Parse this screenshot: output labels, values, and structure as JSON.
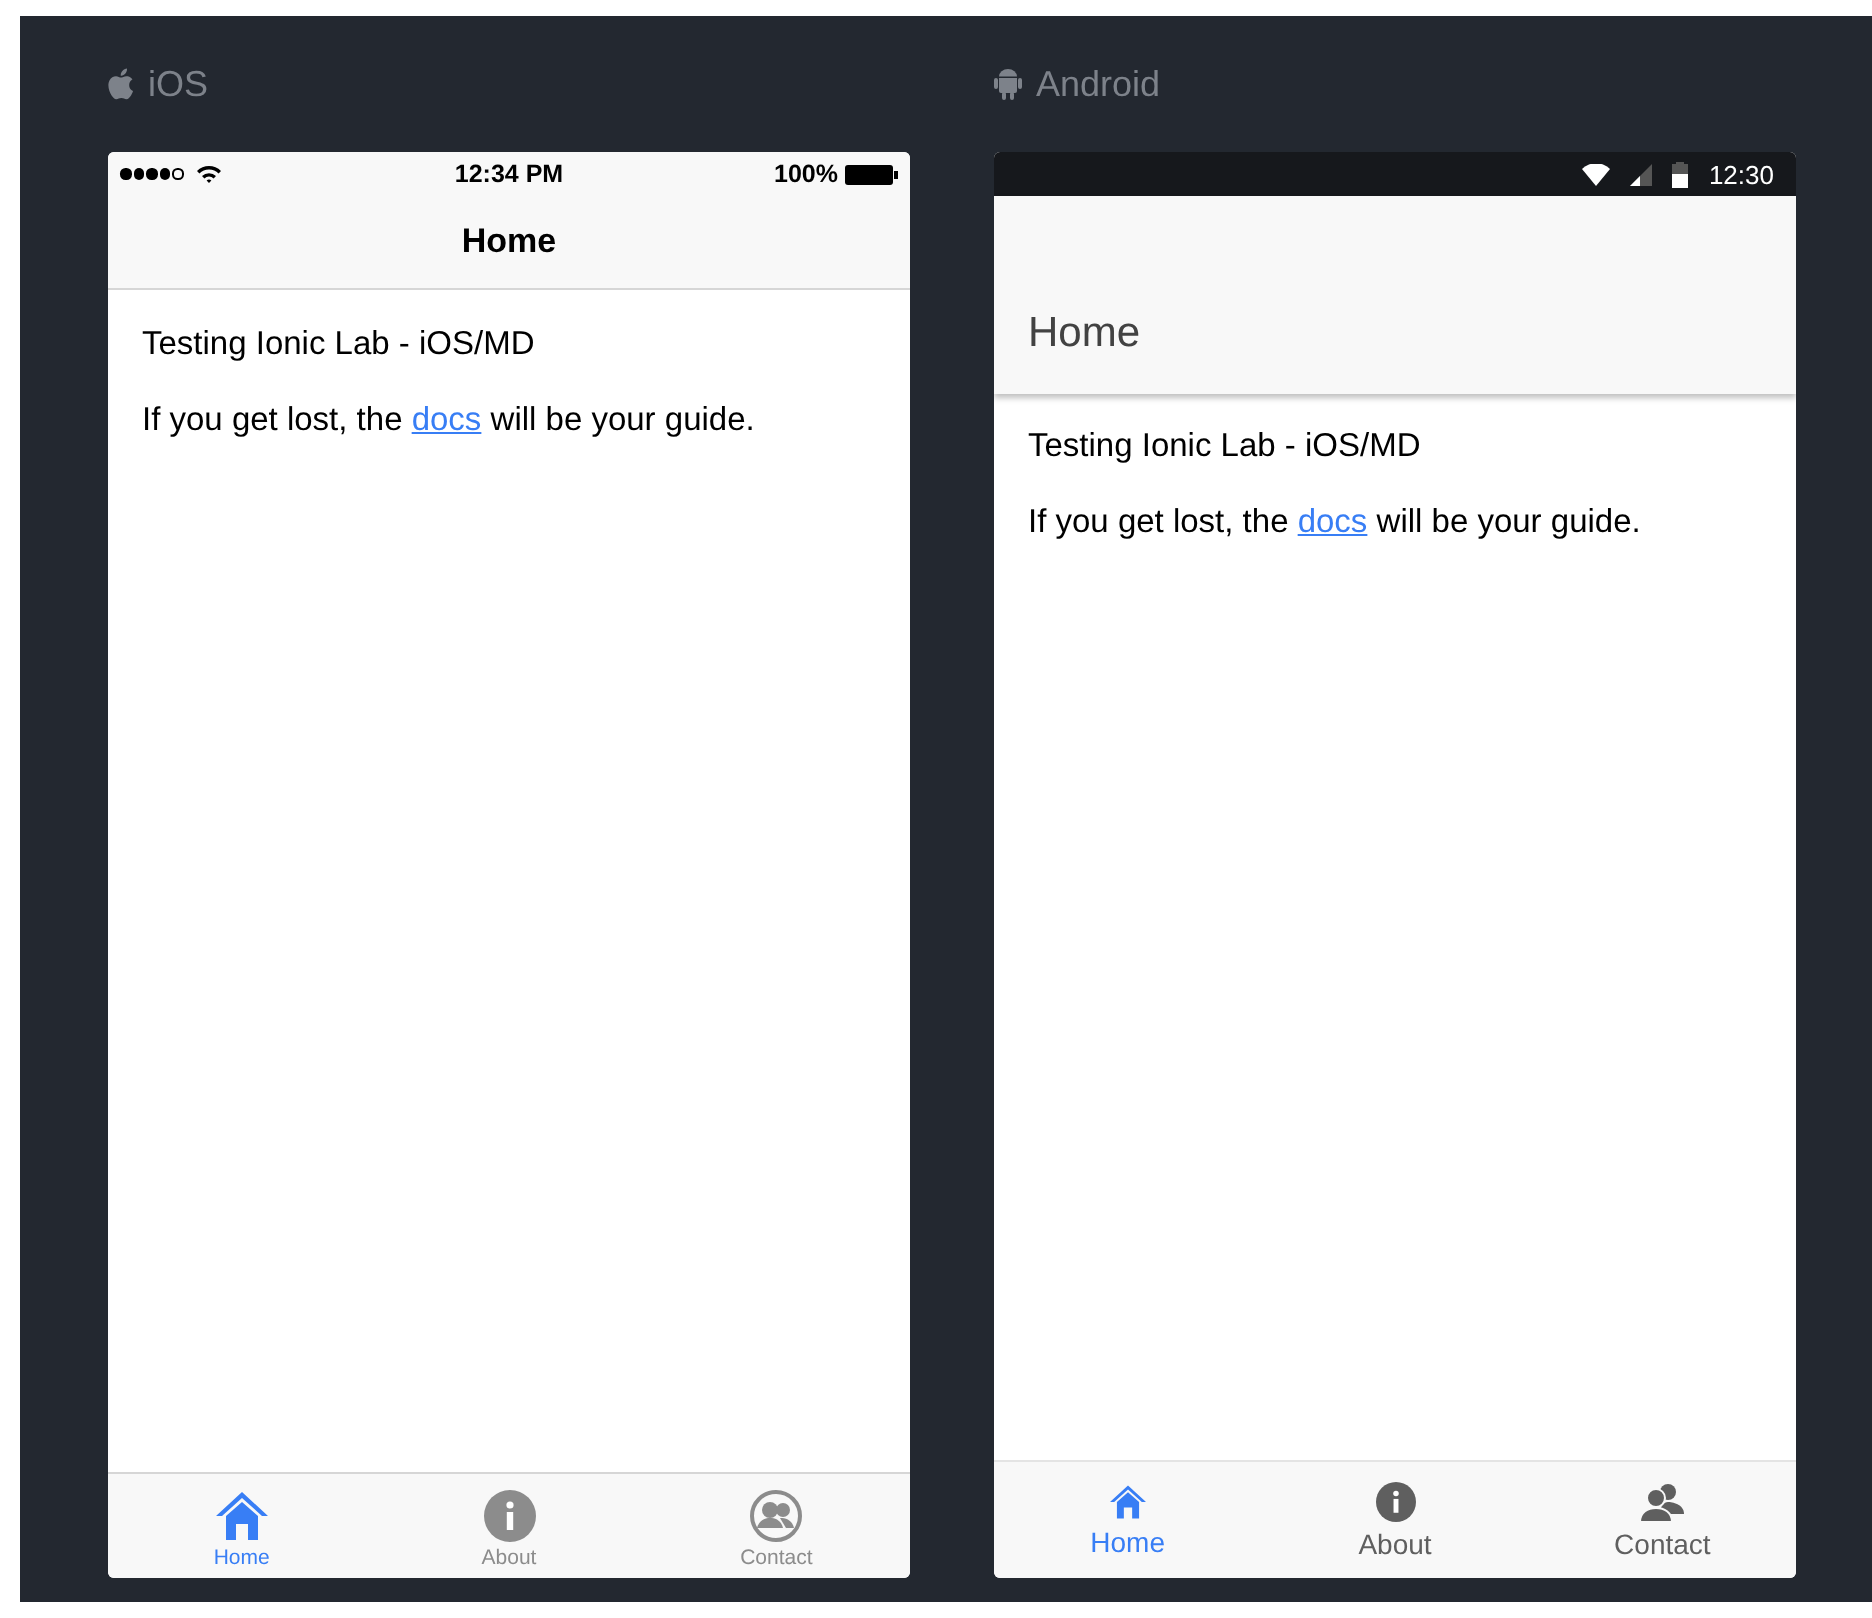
{
  "devices": [
    {
      "kind": "ios",
      "label": "iOS",
      "status_bar": {
        "time": "12:34 PM",
        "battery": "100%"
      },
      "title": "Home",
      "heading": "Testing Ionic Lab - iOS/MD",
      "paragraph": {
        "before": "If you get lost, the ",
        "link": "docs",
        "after": " will be your guide."
      },
      "tabs": [
        {
          "label": "Home",
          "selected": true
        },
        {
          "label": "About",
          "selected": false
        },
        {
          "label": "Contact",
          "selected": false
        }
      ]
    },
    {
      "kind": "android",
      "label": "Android",
      "status_bar": {
        "time": "12:30"
      },
      "title": "Home",
      "heading": "Testing Ionic Lab - iOS/MD",
      "paragraph": {
        "before": "If you get lost, the ",
        "link": "docs",
        "after": " will be your guide."
      },
      "tabs": [
        {
          "label": "Home",
          "selected": true
        },
        {
          "label": "About",
          "selected": false
        },
        {
          "label": "Contact",
          "selected": false
        }
      ]
    }
  ]
}
